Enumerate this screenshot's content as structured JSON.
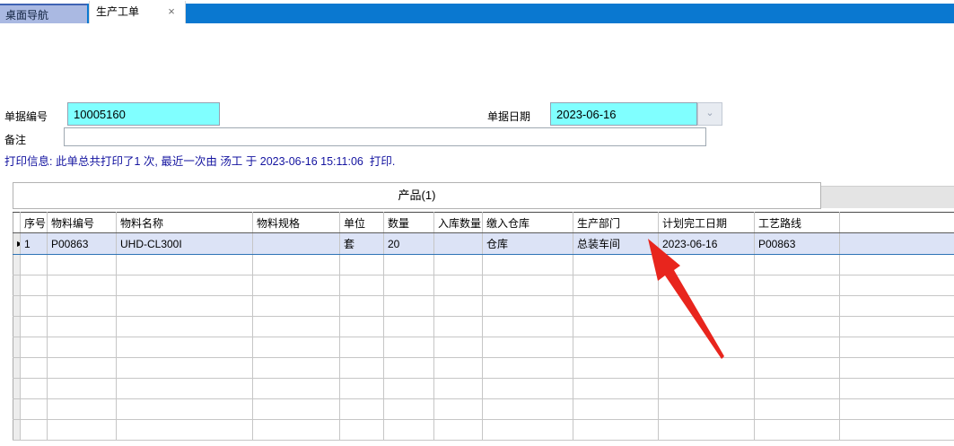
{
  "tabs": {
    "desktop_nav": "桌面导航",
    "production_order": "生产工单",
    "close_icon": "×"
  },
  "form": {
    "doc_no_label": "单据编号",
    "doc_no_value": "10005160",
    "doc_date_label": "单据日期",
    "doc_date_value": "2023-06-16",
    "remark_label": "备注",
    "remark_value": "",
    "print_info": "打印信息: 此单总共打印了1 次, 最近一次由 汤工 于 2023-06-16 15:11:06  打印."
  },
  "product_panel": {
    "tab_label": "产品(1)",
    "grid": {
      "columns": [
        "序号",
        "物料编号",
        "物料名称",
        "物料规格",
        "单位",
        "数量",
        "入库数量",
        "缴入仓库",
        "生产部门",
        "计划完工日期",
        "工艺路线",
        ""
      ],
      "rows": [
        [
          "1",
          "P00863",
          "UHD-CL300I",
          "",
          "套",
          "20",
          "",
          "仓库",
          "总装车间",
          "2023-06-16",
          "P00863",
          ""
        ]
      ],
      "row_marker": "▶",
      "empty_row_count": 9
    }
  },
  "icons": {
    "chevron_down": "⌄"
  },
  "colors": {
    "tabbar_blue": "#0a78d0",
    "inactive_tab": "#aab9e2",
    "field_cyan": "#80ffff",
    "print_info_text": "#1414a0",
    "selected_row": "#dce3f6",
    "arrow_red": "#e8251d"
  }
}
